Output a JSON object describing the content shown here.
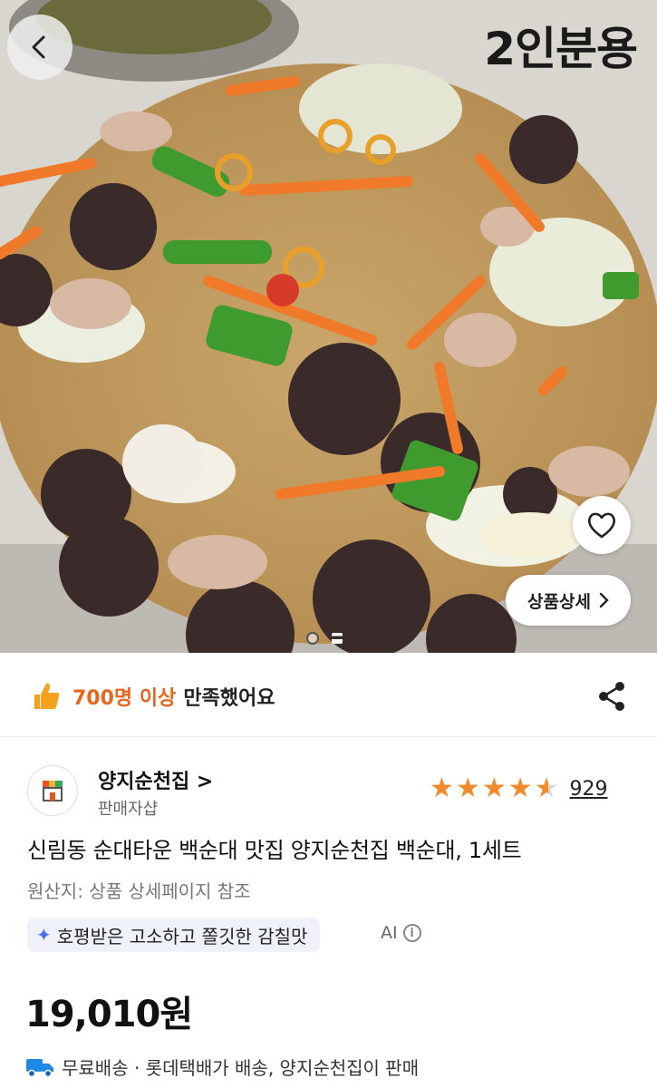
{
  "hero": {
    "tag": "2인분용",
    "detail_label": "상품상세"
  },
  "icons": {
    "back": "chevron-left-icon",
    "heart": "heart-icon",
    "share": "share-icon",
    "thumb": "thumbs-up-icon",
    "spark": "sparkle-icon",
    "info": "info-icon",
    "truck": "truck-icon"
  },
  "satisfaction": {
    "count": "700명 이상",
    "text": "만족했어요"
  },
  "seller": {
    "name": "양지순천집 >",
    "label": "판매자샵"
  },
  "rating": {
    "stars": 4.5,
    "review_count": "929"
  },
  "product": {
    "title": "신림동 순대타운 백순대 맛집 양지순천집 백순대, 1세트",
    "origin": "원산지: 상품 상세페이지 참조",
    "ai_summary": "호평받은 고소하고 쫄깃한 감칠맛",
    "ai_label": "AI",
    "price": "19,010원"
  },
  "shipping": {
    "text": "무료배송 · 롯데택배가 배송, 양지순천집이 판매"
  },
  "colors": {
    "accent": "#e8651e",
    "star": "#f58a2a",
    "ai_chip_bg": "#eef1f8",
    "truck": "#1e88e5"
  }
}
